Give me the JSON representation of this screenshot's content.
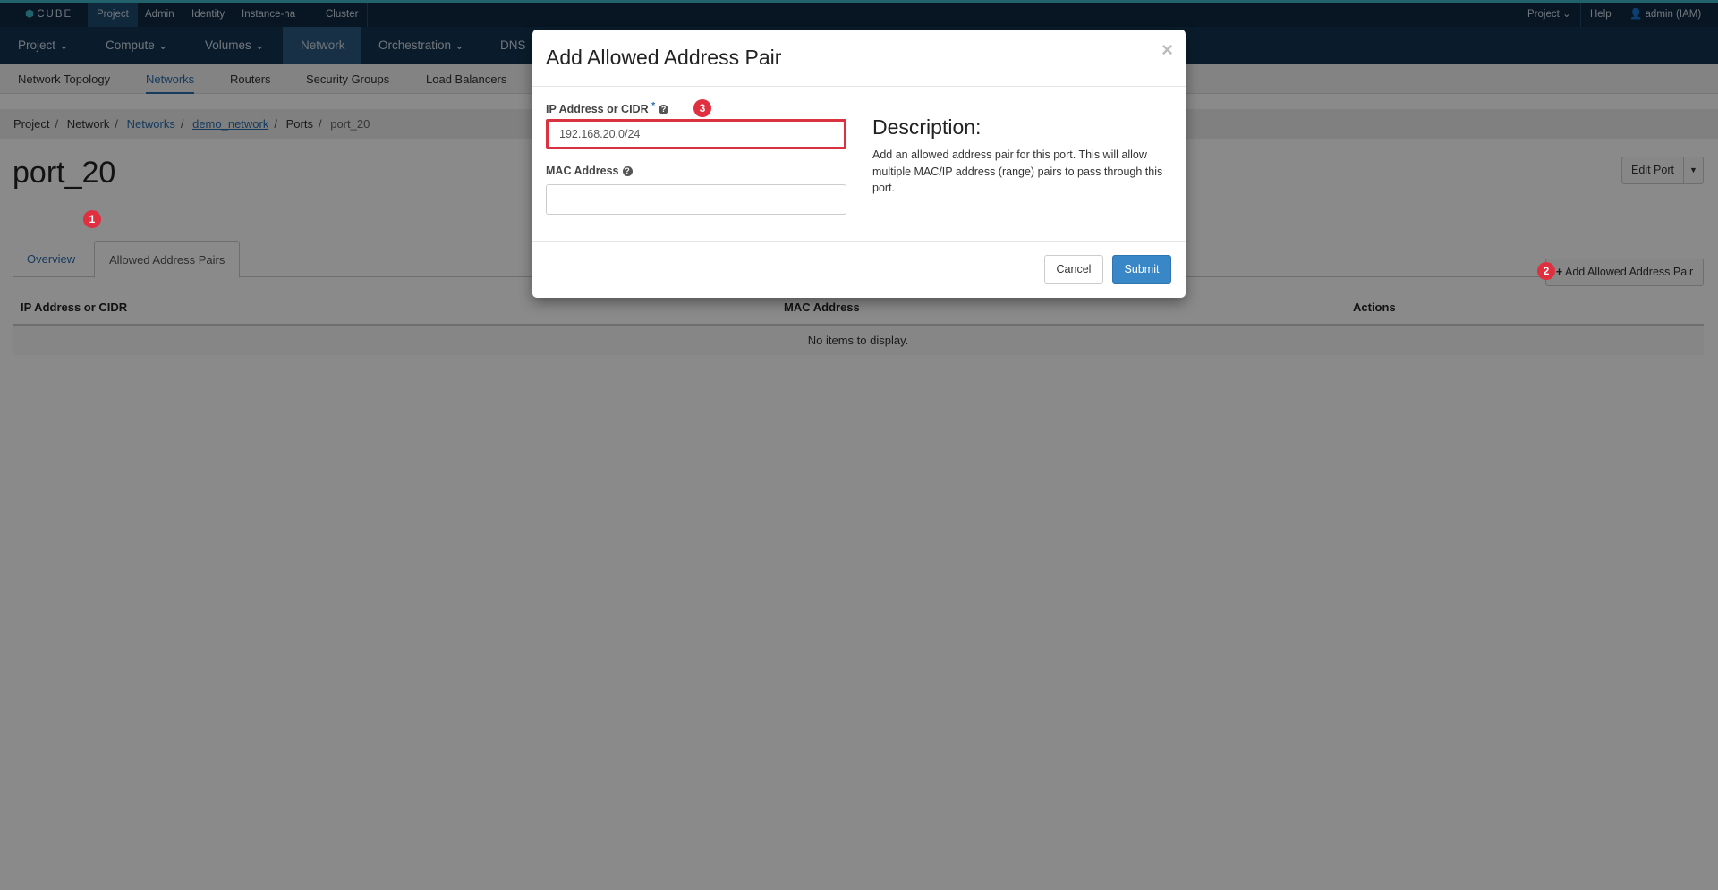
{
  "topbar": {
    "brand": "CUBE",
    "items": [
      "Project",
      "Admin",
      "Identity",
      "Instance-ha",
      "Cluster"
    ],
    "right": {
      "project": "Project",
      "help": "Help",
      "user": "admin (IAM)"
    }
  },
  "mainnav": {
    "items": [
      "Project",
      "Compute",
      "Volumes",
      "Network",
      "Orchestration",
      "DNS"
    ]
  },
  "subnav": {
    "items": [
      "Network Topology",
      "Networks",
      "Routers",
      "Security Groups",
      "Load Balancers"
    ]
  },
  "breadcrumb": [
    "Project",
    "Network",
    "Networks",
    "demo_network",
    "Ports",
    "port_20"
  ],
  "page": {
    "title": "port_20",
    "edit_port": "Edit Port",
    "tabs": [
      "Overview",
      "Allowed Address Pairs"
    ],
    "add_button": "Add Allowed Address Pair"
  },
  "table": {
    "headers": [
      "IP Address or CIDR",
      "MAC Address",
      "Actions"
    ],
    "empty": "No items to display."
  },
  "badges": [
    "1",
    "2",
    "3"
  ],
  "modal": {
    "title": "Add Allowed Address Pair",
    "close": "×",
    "ip_label": "IP Address or CIDR",
    "required": "*",
    "ip_value": "192.168.20.0/24",
    "mac_label": "MAC Address",
    "mac_value": "",
    "desc_title": "Description:",
    "desc_text": "Add an allowed address pair for this port. This will allow multiple MAC/IP address (range) pairs to pass through this port.",
    "cancel": "Cancel",
    "submit": "Submit"
  },
  "colors": {
    "accent": "#2a6eb0",
    "nav": "#133451",
    "badge": "#e03040",
    "submit": "#3a87c8"
  }
}
